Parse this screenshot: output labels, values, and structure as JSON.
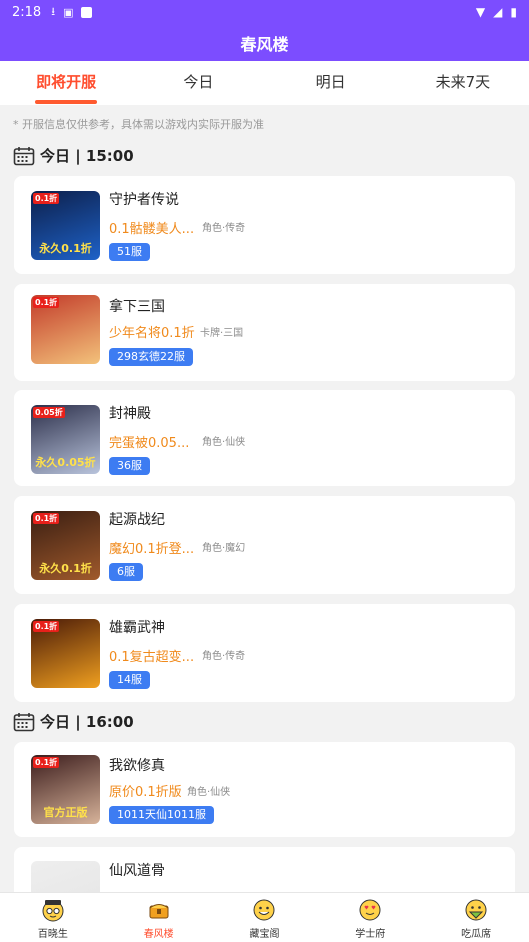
{
  "status": {
    "time": "2:18"
  },
  "header": {
    "title": "春风楼"
  },
  "tabs": [
    "即将开服",
    "今日",
    "明日",
    "未来7天"
  ],
  "notice": "* 开服信息仅供参考，具体需以游戏内实际开服为准",
  "sections": [
    {
      "title": "今日 | 15:00",
      "games": [
        {
          "name": "守护者传说",
          "promo": "0.1骷髅美人...",
          "tags": "角色·传奇",
          "server": "51服",
          "thumb_label": "永久0.1折",
          "thumb_corner": "0.1折",
          "thumb_colors": [
            "#0d1f4a",
            "#1e62c8"
          ]
        },
        {
          "name": "拿下三国",
          "promo": "少年名将0.1折",
          "tags": "卡牌·三国",
          "server": "298玄德22服",
          "thumb_label": "",
          "thumb_corner": "0.1折",
          "thumb_colors": [
            "#c23b2a",
            "#f3c27b"
          ]
        },
        {
          "name": "封神殿",
          "promo": "完蛋被0.05...",
          "tags": "角色·仙侠",
          "server": "36服",
          "thumb_label": "永久0.05折",
          "thumb_corner": "0.05折",
          "thumb_colors": [
            "#2c2f4a",
            "#b9c4dc"
          ]
        },
        {
          "name": "起源战纪",
          "promo": "魔幻0.1折登...",
          "tags": "角色·魔幻",
          "server": "6服",
          "thumb_label": "永久0.1折",
          "thumb_corner": "0.1折",
          "thumb_colors": [
            "#3a1e12",
            "#a05a2c"
          ]
        },
        {
          "name": "雄霸武神",
          "promo": "0.1复古超变...",
          "tags": "角色·传奇",
          "server": "14服",
          "thumb_label": "",
          "thumb_corner": "0.1折",
          "thumb_colors": [
            "#4a1a08",
            "#f0a020"
          ]
        }
      ]
    },
    {
      "title": "今日 | 16:00",
      "games": [
        {
          "name": "我欲修真",
          "promo": "原价0.1折版",
          "tags": "角色·仙侠",
          "server": "1011天仙1011服",
          "thumb_label": "官方正版",
          "thumb_corner": "0.1折",
          "thumb_colors": [
            "#3b1c1c",
            "#d7b39a"
          ]
        },
        {
          "name": "仙风道骨",
          "promo": "",
          "tags": "",
          "server": "",
          "thumb_label": "",
          "thumb_corner": "",
          "thumb_colors": [
            "#eeeeee",
            "#e4e4e4"
          ]
        }
      ]
    }
  ],
  "nav": [
    {
      "label": "百晓生",
      "icon": "scholar-face-icon"
    },
    {
      "label": "春风楼",
      "icon": "treasure-chest-icon"
    },
    {
      "label": "藏宝阁",
      "icon": "happy-face-icon"
    },
    {
      "label": "学士府",
      "icon": "heart-face-icon"
    },
    {
      "label": "吃瓜席",
      "icon": "melon-face-icon"
    }
  ],
  "colors": {
    "brand": "#7c4dff",
    "accent": "#ff4d2e",
    "badge": "#3d7cf2",
    "promo": "#f08a1c"
  }
}
